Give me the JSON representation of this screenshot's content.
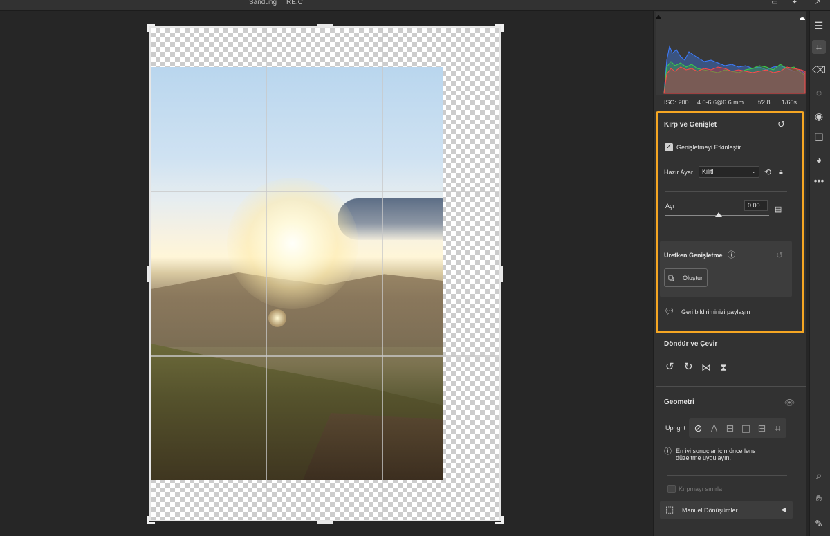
{
  "topbar": {
    "title_left": "Sandung",
    "title_right": "RE.C"
  },
  "histogram": {
    "iso": "ISO: 200",
    "lens": "4.0-6.6@6.6 mm",
    "aperture": "f/2.8",
    "shutter": "1/60s"
  },
  "crop_panel": {
    "title": "Kırp ve Genişlet",
    "enable_expand_label": "Genişletmeyi Etkinleştir",
    "enable_expand_checked": true,
    "preset_label": "Hazır Ayar",
    "preset_value": "Kilitli",
    "angle_label": "Açı",
    "angle_value": "0.00",
    "angle_slider_level": 0.5,
    "generative_title": "Üretken Genişletme",
    "generate_button": "Oluştur",
    "feedback_label": "Geri bildiriminizi paylaşın",
    "highlight_color": "#f5a623"
  },
  "rotate_panel": {
    "title": "Döndür ve Çevir",
    "icons": [
      "rotate-left-icon",
      "rotate-right-icon",
      "flip-horizontal-icon",
      "flip-vertical-icon"
    ]
  },
  "geometry_panel": {
    "title": "Geometri",
    "upright_label": "Upright",
    "upright_options": [
      "off",
      "auto",
      "level",
      "vertical",
      "full",
      "guided"
    ],
    "lens_hint": "En iyi sonuçlar için önce lens düzeltme uygulayın.",
    "constrain_crop_label": "Kırpmayı sınırla",
    "manual_transforms_label": "Manuel Dönüşümler"
  },
  "toolrail": {
    "tools": [
      "edit-icon",
      "crop-icon",
      "eraser-icon",
      "healing-icon",
      "redeye-icon",
      "layers-icon",
      "presets-icon",
      "more-icon",
      "zoom-icon",
      "hand-icon",
      "sampler-icon"
    ]
  }
}
